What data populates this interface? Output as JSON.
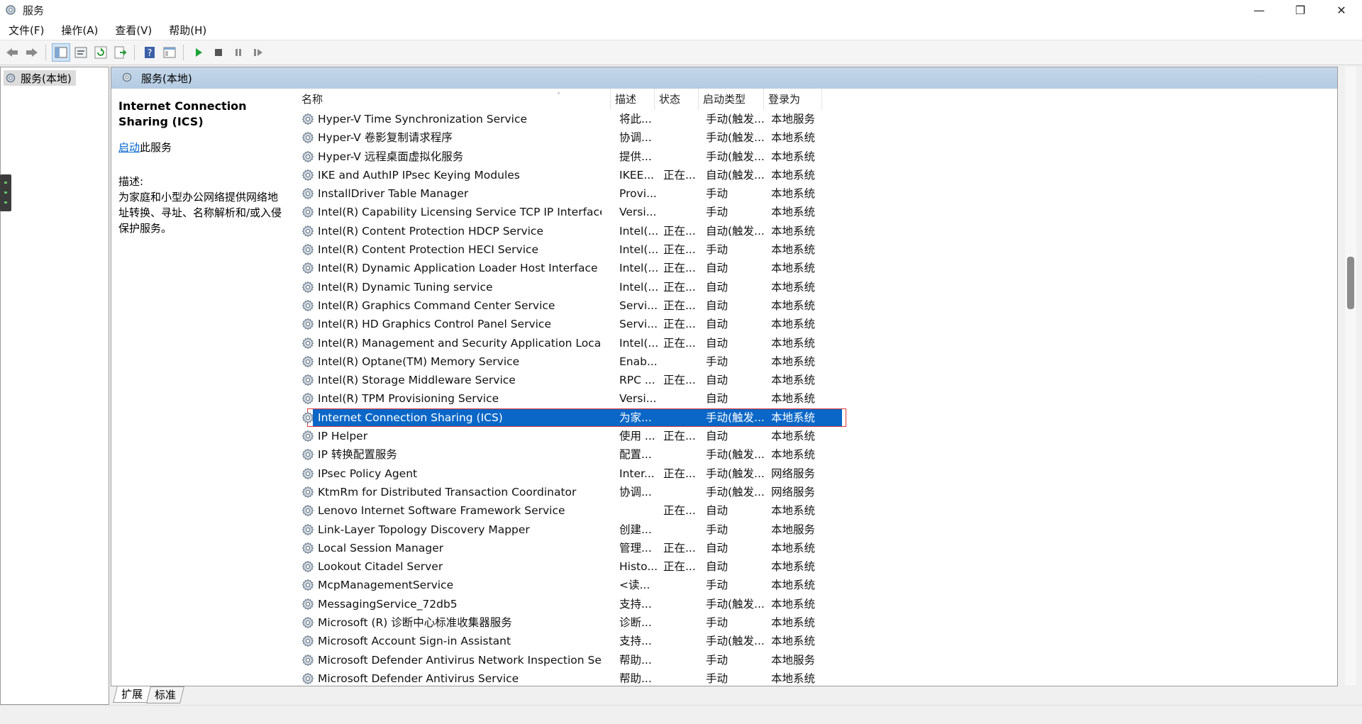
{
  "window": {
    "title": "服务",
    "controls": [
      "minimize-icon",
      "restore-icon",
      "close-icon"
    ]
  },
  "menu": [
    {
      "label": "文件(F)"
    },
    {
      "label": "操作(A)"
    },
    {
      "label": "查看(V)"
    },
    {
      "label": "帮助(H)"
    }
  ],
  "toolbar": {
    "icons": [
      "back-icon",
      "forward-icon",
      "show-hide-tree-icon",
      "properties-icon",
      "refresh-icon",
      "export-list-icon",
      "help-icon",
      "console-view-icon",
      "start-service-icon",
      "stop-service-icon",
      "pause-service-icon",
      "resume-service-icon"
    ]
  },
  "tree": {
    "root_label": "服务(本地)"
  },
  "pane": {
    "header": "服务(本地)",
    "selected_service_name": "Internet Connection Sharing (ICS)",
    "start_link": "启动",
    "start_suffix": "此服务",
    "desc_label": "描述:",
    "desc_text": "为家庭和小型办公网络提供网络地址转换、寻址、名称解析和/或入侵保护服务。"
  },
  "columns": {
    "name": "名称",
    "desc": "描述",
    "status": "状态",
    "startup": "启动类型",
    "logon": "登录为"
  },
  "services": [
    {
      "name": "Hyper-V Time Synchronization Service",
      "desc": "将此...",
      "status": "",
      "startup": "手动(触发...",
      "logon": "本地服务"
    },
    {
      "name": "Hyper-V 卷影复制请求程序",
      "desc": "协调...",
      "status": "",
      "startup": "手动(触发...",
      "logon": "本地系统"
    },
    {
      "name": "Hyper-V 远程桌面虚拟化服务",
      "desc": "提供...",
      "status": "",
      "startup": "手动(触发...",
      "logon": "本地系统"
    },
    {
      "name": "IKE and AuthIP IPsec Keying Modules",
      "desc": "IKEE...",
      "status": "正在...",
      "startup": "自动(触发...",
      "logon": "本地系统"
    },
    {
      "name": "InstallDriver Table Manager",
      "desc": "Provi...",
      "status": "",
      "startup": "手动",
      "logon": "本地系统"
    },
    {
      "name": "Intel(R) Capability Licensing Service TCP IP Interface",
      "desc": "Versi...",
      "status": "",
      "startup": "手动",
      "logon": "本地系统"
    },
    {
      "name": "Intel(R) Content Protection HDCP Service",
      "desc": "Intel(...",
      "status": "正在...",
      "startup": "自动(触发...",
      "logon": "本地系统"
    },
    {
      "name": "Intel(R) Content Protection HECI Service",
      "desc": "Intel(...",
      "status": "正在...",
      "startup": "手动",
      "logon": "本地系统"
    },
    {
      "name": "Intel(R) Dynamic Application Loader Host Interface Service",
      "desc": "Intel(...",
      "status": "正在...",
      "startup": "自动",
      "logon": "本地系统"
    },
    {
      "name": "Intel(R) Dynamic Tuning service",
      "desc": "Intel(...",
      "status": "正在...",
      "startup": "自动",
      "logon": "本地系统"
    },
    {
      "name": "Intel(R) Graphics Command Center Service",
      "desc": "Servi...",
      "status": "正在...",
      "startup": "自动",
      "logon": "本地系统"
    },
    {
      "name": "Intel(R) HD Graphics Control Panel Service",
      "desc": "Servi...",
      "status": "正在...",
      "startup": "自动",
      "logon": "本地系统"
    },
    {
      "name": "Intel(R) Management and Security Application Local Mana...",
      "desc": "Intel(...",
      "status": "正在...",
      "startup": "自动",
      "logon": "本地系统"
    },
    {
      "name": "Intel(R) Optane(TM) Memory Service",
      "desc": "Enab...",
      "status": "",
      "startup": "手动",
      "logon": "本地系统"
    },
    {
      "name": "Intel(R) Storage Middleware Service",
      "desc": "RPC ...",
      "status": "正在...",
      "startup": "自动",
      "logon": "本地系统"
    },
    {
      "name": "Intel(R) TPM Provisioning Service",
      "desc": "Versi...",
      "status": "",
      "startup": "自动",
      "logon": "本地系统"
    },
    {
      "name": "Internet Connection Sharing (ICS)",
      "desc": "为家...",
      "status": "",
      "startup": "手动(触发...",
      "logon": "本地系统",
      "selected": true
    },
    {
      "name": "IP Helper",
      "desc": "使用 ...",
      "status": "正在...",
      "startup": "自动",
      "logon": "本地系统"
    },
    {
      "name": "IP 转换配置服务",
      "desc": "配置...",
      "status": "",
      "startup": "手动(触发...",
      "logon": "本地系统"
    },
    {
      "name": "IPsec Policy Agent",
      "desc": "Inter...",
      "status": "正在...",
      "startup": "手动(触发...",
      "logon": "网络服务"
    },
    {
      "name": "KtmRm for Distributed Transaction Coordinator",
      "desc": "协调...",
      "status": "",
      "startup": "手动(触发...",
      "logon": "网络服务"
    },
    {
      "name": "Lenovo Internet Software Framework Service",
      "desc": "",
      "status": "正在...",
      "startup": "自动",
      "logon": "本地系统"
    },
    {
      "name": "Link-Layer Topology Discovery Mapper",
      "desc": "创建...",
      "status": "",
      "startup": "手动",
      "logon": "本地服务"
    },
    {
      "name": "Local Session Manager",
      "desc": "管理...",
      "status": "正在...",
      "startup": "自动",
      "logon": "本地系统"
    },
    {
      "name": "Lookout Citadel Server",
      "desc": "Histo...",
      "status": "正在...",
      "startup": "自动",
      "logon": "本地系统"
    },
    {
      "name": "McpManagementService",
      "desc": "<读...",
      "status": "",
      "startup": "手动",
      "logon": "本地系统"
    },
    {
      "name": "MessagingService_72db5",
      "desc": "支持...",
      "status": "",
      "startup": "手动(触发...",
      "logon": "本地系统"
    },
    {
      "name": "Microsoft (R) 诊断中心标准收集器服务",
      "desc": "诊断...",
      "status": "",
      "startup": "手动",
      "logon": "本地系统"
    },
    {
      "name": "Microsoft Account Sign-in Assistant",
      "desc": "支持...",
      "status": "",
      "startup": "手动(触发...",
      "logon": "本地系统"
    },
    {
      "name": "Microsoft Defender Antivirus Network Inspection Service",
      "desc": "帮助...",
      "status": "",
      "startup": "手动",
      "logon": "本地服务"
    },
    {
      "name": "Microsoft Defender Antivirus Service",
      "desc": "帮助...",
      "status": "",
      "startup": "手动",
      "logon": "本地系统"
    }
  ],
  "tabs": [
    {
      "label": "扩展"
    },
    {
      "label": "标准"
    }
  ]
}
